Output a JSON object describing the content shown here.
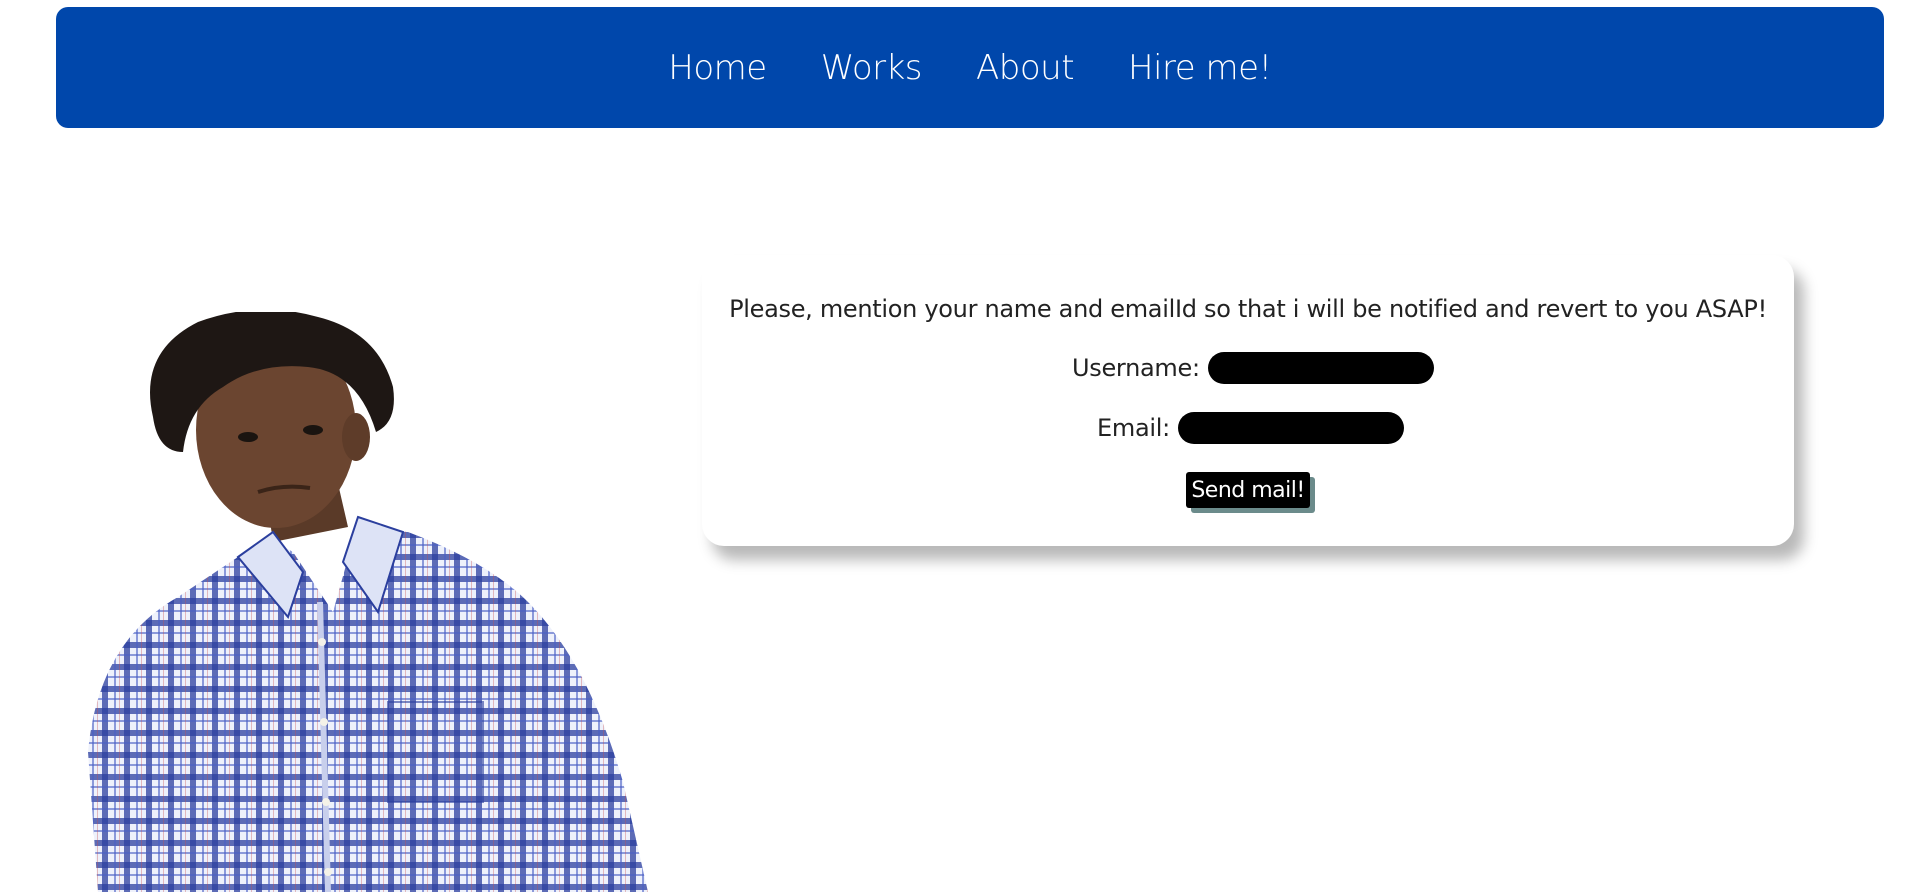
{
  "nav": {
    "items": [
      {
        "label": "Home"
      },
      {
        "label": "Works"
      },
      {
        "label": "About"
      },
      {
        "label": "Hire me!"
      }
    ],
    "background_color": "#0047AB"
  },
  "contact_card": {
    "message": "Please, mention your name and emailId so that i will be notified and revert to you ASAP!",
    "username_label": "Username:",
    "username_value": "",
    "email_label": "Email:",
    "email_value": "",
    "send_label": "Send mail!"
  },
  "profile_photo": {
    "description_icon": "person-photo"
  }
}
